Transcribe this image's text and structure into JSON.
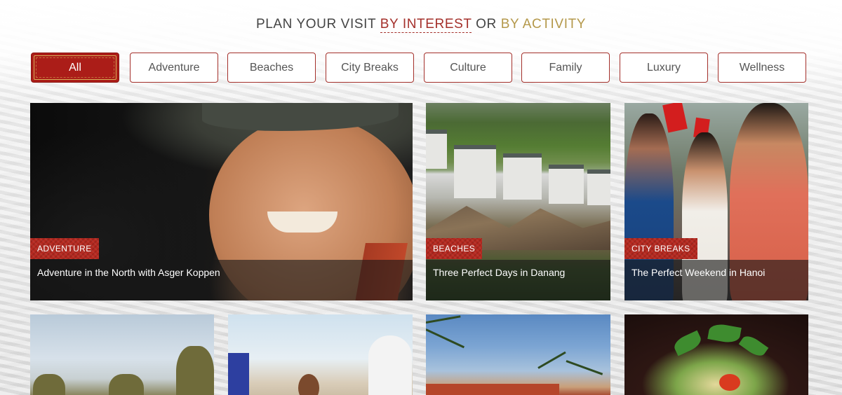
{
  "heading": {
    "prefix": "PLAN YOUR VISIT ",
    "interest": "BY INTEREST",
    "middle": " OR ",
    "activity": "BY ACTIVITY"
  },
  "filters": [
    {
      "label": "All",
      "active": true
    },
    {
      "label": "Adventure"
    },
    {
      "label": "Beaches"
    },
    {
      "label": "City Breaks"
    },
    {
      "label": "Culture"
    },
    {
      "label": "Family"
    },
    {
      "label": "Luxury"
    },
    {
      "label": "Wellness"
    }
  ],
  "cards": [
    {
      "tag": "ADVENTURE",
      "title": "Adventure in the North with Asger Koppen"
    },
    {
      "tag": "BEACHES",
      "title": "Three Perfect Days in Danang"
    },
    {
      "tag": "CITY BREAKS",
      "title": "The Perfect Weekend in Hanoi"
    }
  ],
  "colors": {
    "accent_red": "#ab1d18",
    "accent_gold": "#b4984a",
    "link_red": "#a4302b"
  }
}
